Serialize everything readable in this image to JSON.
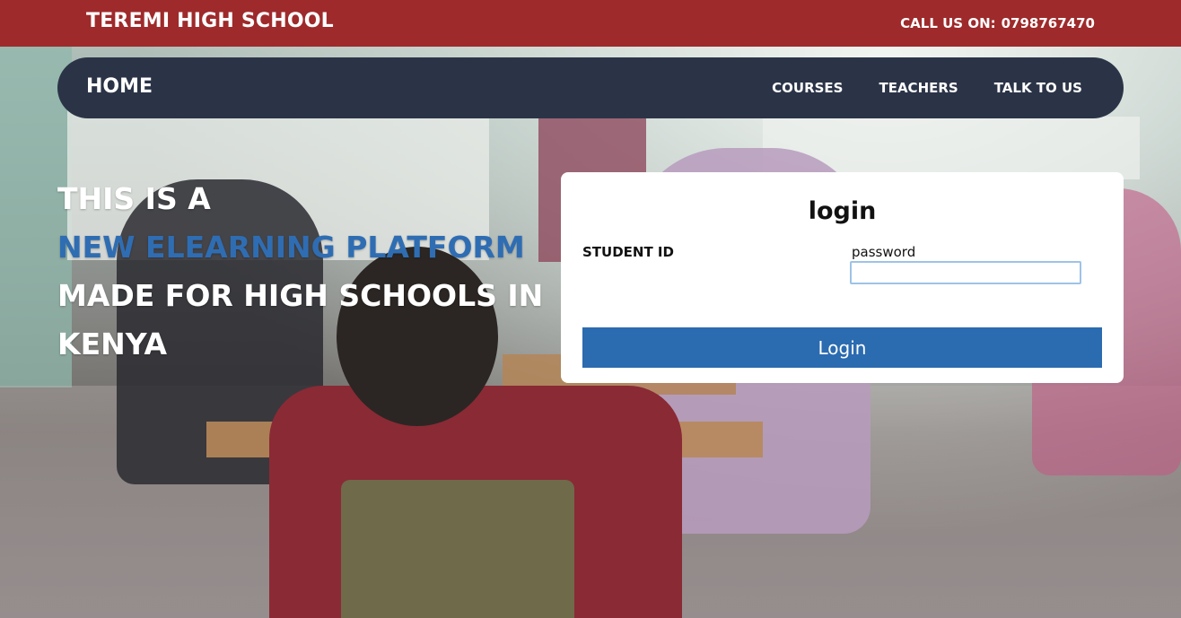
{
  "topbar": {
    "school_name": "TEREMI HIGH SCHOOL",
    "call_label": "CALL US ON:",
    "phone": "0798767470",
    "color": "#9e2a2b"
  },
  "nav": {
    "home": "HOME",
    "links": [
      "COURSES",
      "TEACHERS",
      "TALK TO US"
    ],
    "color": "#2b3447"
  },
  "hero": {
    "line1": "THIS IS A",
    "line2": "NEW ELEARNING PLATFORM",
    "line3": "MADE FOR HIGH SCHOOLS IN",
    "line4": "KENYA",
    "accent_color": "#2f6db3"
  },
  "login": {
    "title": "login",
    "student_id_label": "STUDENT ID",
    "password_label": "password",
    "password_value": "",
    "button_label": "Login",
    "button_color": "#2b6bb0"
  },
  "background": {
    "image": "classroom-photo"
  }
}
